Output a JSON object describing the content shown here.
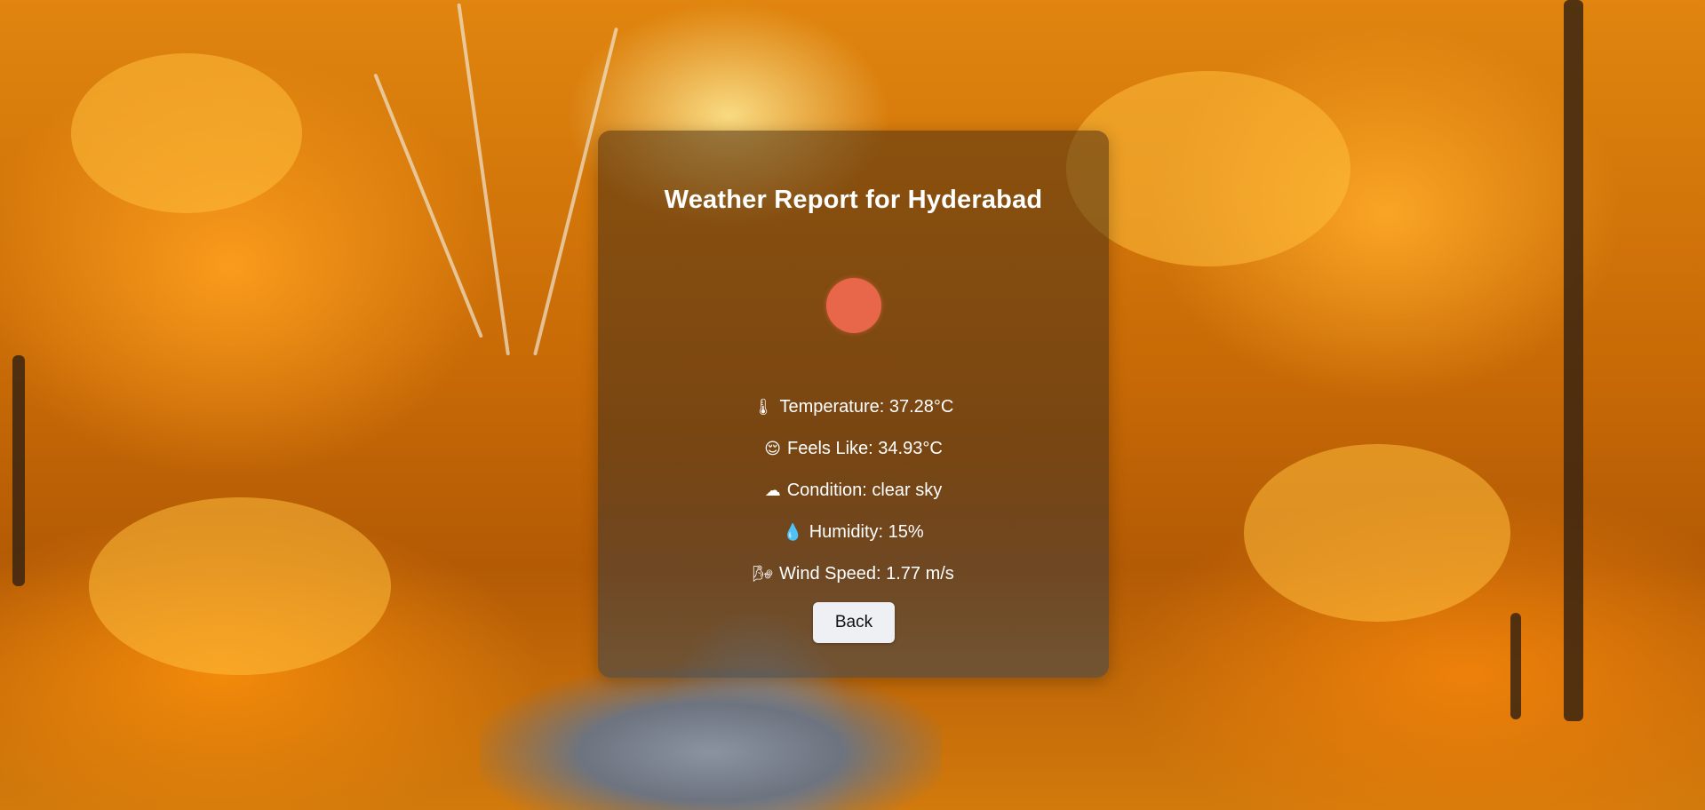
{
  "report": {
    "title": "Weather Report for Hyderabad",
    "weather_icon": "sun-icon",
    "temperature": {
      "icon": "🌡",
      "text": "Temperature: 37.28°C"
    },
    "feels_like": {
      "icon": "😌",
      "text": "Feels Like: 34.93°C"
    },
    "condition": {
      "icon": "☁",
      "text": "Condition: clear sky"
    },
    "humidity": {
      "icon": "💧",
      "text": "Humidity: 15%"
    },
    "wind_speed": {
      "icon": "🌬",
      "text": "Wind Speed: 1.77 m/s"
    },
    "back_label": "Back"
  },
  "colors": {
    "sun": "#e8674a",
    "button_bg": "#eef0f3"
  }
}
